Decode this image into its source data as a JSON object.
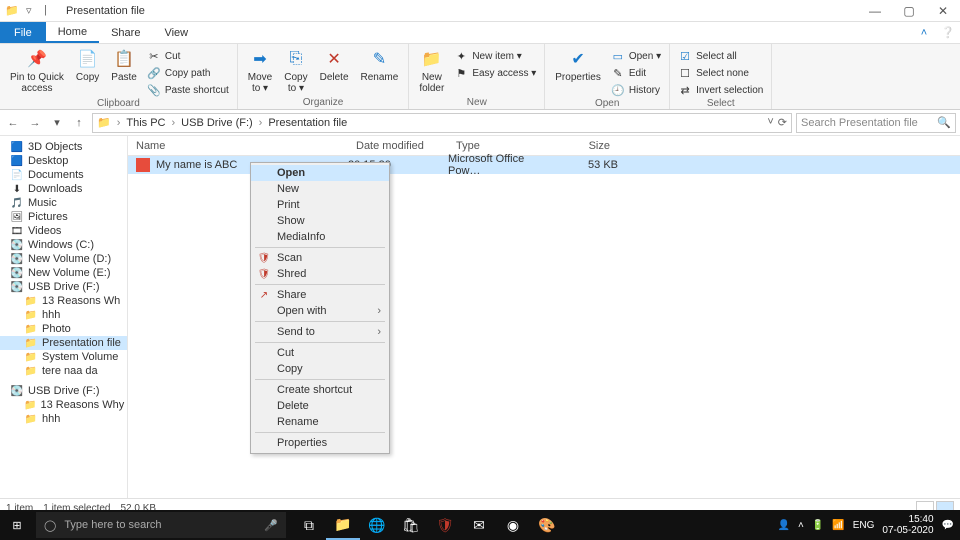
{
  "window": {
    "title": "Presentation file"
  },
  "tabs": {
    "file": "File",
    "home": "Home",
    "share": "Share",
    "view": "View"
  },
  "ribbon": {
    "clipboard": {
      "label": "Clipboard",
      "pin": "Pin to Quick\naccess",
      "copy": "Copy",
      "paste": "Paste",
      "cut": "Cut",
      "copypath": "Copy path",
      "pasteshortcut": "Paste shortcut"
    },
    "organize": {
      "label": "Organize",
      "moveto": "Move\nto ▾",
      "copyto": "Copy\nto ▾",
      "delete": "Delete",
      "rename": "Rename"
    },
    "new": {
      "label": "New",
      "newfolder": "New\nfolder",
      "newitem": "New item ▾",
      "easyaccess": "Easy access ▾"
    },
    "open": {
      "label": "Open",
      "properties": "Properties",
      "open": "Open ▾",
      "edit": "Edit",
      "history": "History"
    },
    "select": {
      "label": "Select",
      "selectall": "Select all",
      "selectnone": "Select none",
      "invert": "Invert selection"
    }
  },
  "address": {
    "crumbs": [
      "This PC",
      "USB Drive (F:)",
      "Presentation file"
    ],
    "search_placeholder": "Search Presentation file"
  },
  "nav": {
    "items": [
      {
        "label": "3D Objects",
        "icon": "🟦"
      },
      {
        "label": "Desktop",
        "icon": "🟦"
      },
      {
        "label": "Documents",
        "icon": "📄"
      },
      {
        "label": "Downloads",
        "icon": "⬇"
      },
      {
        "label": "Music",
        "icon": "🎵"
      },
      {
        "label": "Pictures",
        "icon": "🖼"
      },
      {
        "label": "Videos",
        "icon": "🎞"
      },
      {
        "label": "Windows (C:)",
        "icon": "💽"
      },
      {
        "label": "New Volume (D:)",
        "icon": "💽"
      },
      {
        "label": "New Volume (E:)",
        "icon": "💽"
      },
      {
        "label": "USB Drive (F:)",
        "icon": "💽",
        "expanded": true
      },
      {
        "label": "13 Reasons Wh",
        "icon": "📁",
        "sub": true
      },
      {
        "label": "hhh",
        "icon": "📁",
        "sub": true
      },
      {
        "label": "Photo",
        "icon": "📁",
        "sub": true
      },
      {
        "label": "Presentation file",
        "icon": "📁",
        "sub": true,
        "selected": true
      },
      {
        "label": "System Volume",
        "icon": "📁",
        "sub": true
      },
      {
        "label": "tere naa da",
        "icon": "📁",
        "sub": true
      },
      {
        "label": "USB Drive (F:)",
        "icon": "💽",
        "gap": true
      },
      {
        "label": "13 Reasons Why",
        "icon": "📁",
        "sub": true
      },
      {
        "label": "hhh",
        "icon": "📁",
        "sub": true
      }
    ]
  },
  "columns": {
    "name": "Name",
    "date": "Date modified",
    "type": "Type",
    "size": "Size"
  },
  "files": [
    {
      "name": "My name is ABC",
      "date": "20 15:30",
      "type": "Microsoft Office Pow…",
      "size": "53 KB",
      "selected": true
    }
  ],
  "context_menu": {
    "items": [
      {
        "label": "Open",
        "bold": true,
        "hover": true
      },
      {
        "label": "New"
      },
      {
        "label": "Print"
      },
      {
        "label": "Show"
      },
      {
        "label": "MediaInfo"
      },
      {
        "sep": true
      },
      {
        "label": "Scan",
        "icon": "🛡"
      },
      {
        "label": "Shred",
        "icon": "🛡"
      },
      {
        "sep": true
      },
      {
        "label": "Share",
        "icon": "↗"
      },
      {
        "label": "Open with",
        "arrow": true
      },
      {
        "sep": true
      },
      {
        "label": "Send to",
        "arrow": true
      },
      {
        "sep": true
      },
      {
        "label": "Cut"
      },
      {
        "label": "Copy"
      },
      {
        "sep": true
      },
      {
        "label": "Create shortcut"
      },
      {
        "label": "Delete"
      },
      {
        "label": "Rename"
      },
      {
        "sep": true
      },
      {
        "label": "Properties"
      }
    ]
  },
  "status": {
    "items_count": "1 item",
    "selected": "1 item selected",
    "size": "52.0 KB"
  },
  "taskbar": {
    "search_placeholder": "Type here to search",
    "lang": "ENG",
    "time": "15:40",
    "date": "07-05-2020"
  }
}
